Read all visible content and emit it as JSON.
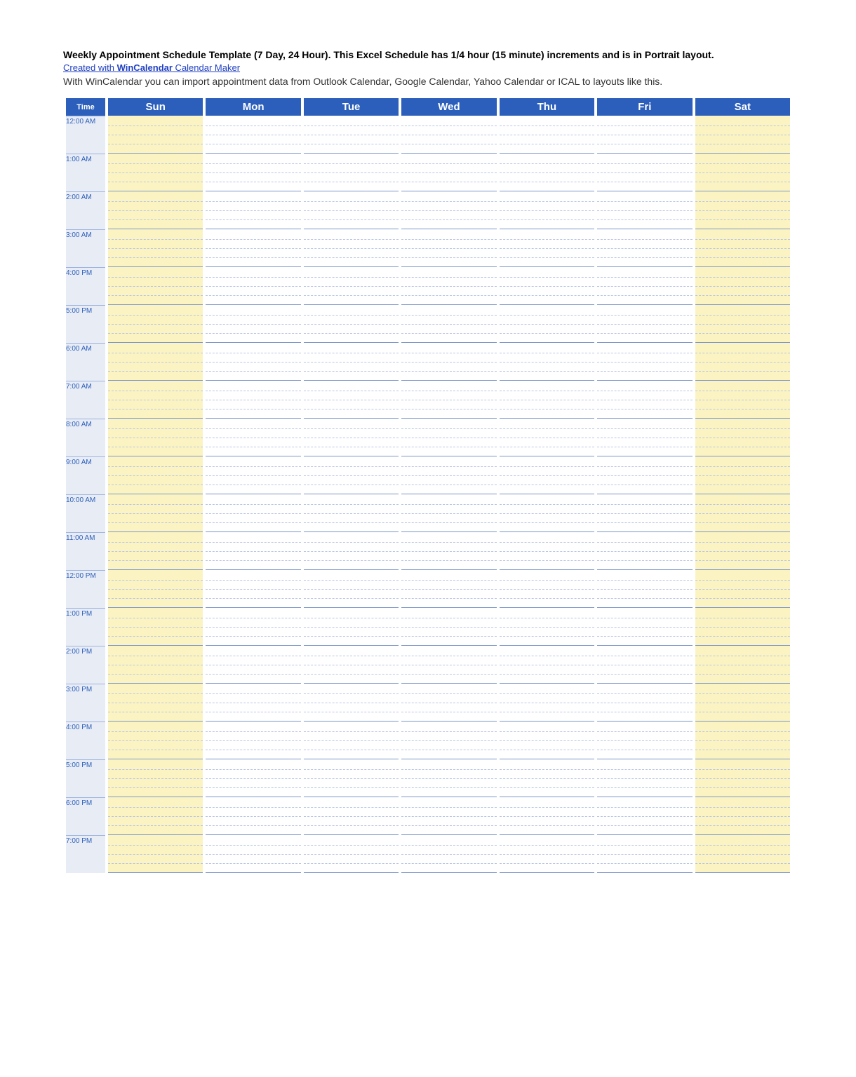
{
  "header": {
    "title": "Weekly Appointment Schedule Template (7 Day, 24 Hour).  This Excel Schedule has 1/4 hour (15 minute) increments and is in Portrait layout.",
    "link_prefix": "Created with ",
    "link_bold": "WinCalendar",
    "link_suffix": " Calendar Maker",
    "description": "With WinCalendar you can import appointment data from Outlook Calendar, Google Calendar, Yahoo Calendar or ICAL to layouts like this."
  },
  "columns": {
    "time": "Time",
    "days": [
      "Sun",
      "Mon",
      "Tue",
      "Wed",
      "Thu",
      "Fri",
      "Sat"
    ]
  },
  "tinted_days": [
    0,
    6
  ],
  "hours": [
    "12:00 AM",
    "1:00 AM",
    "2:00 AM",
    "3:00 AM",
    "4:00 PM",
    "5:00 PM",
    "6:00 AM",
    "7:00 AM",
    "8:00 AM",
    "9:00 AM",
    "10:00 AM",
    "11:00 AM",
    "12:00 PM",
    "1:00 PM",
    "2:00 PM",
    "3:00 PM",
    "4:00 PM",
    "5:00 PM",
    "6:00 PM",
    "7:00 PM"
  ],
  "slots_per_hour": 4
}
